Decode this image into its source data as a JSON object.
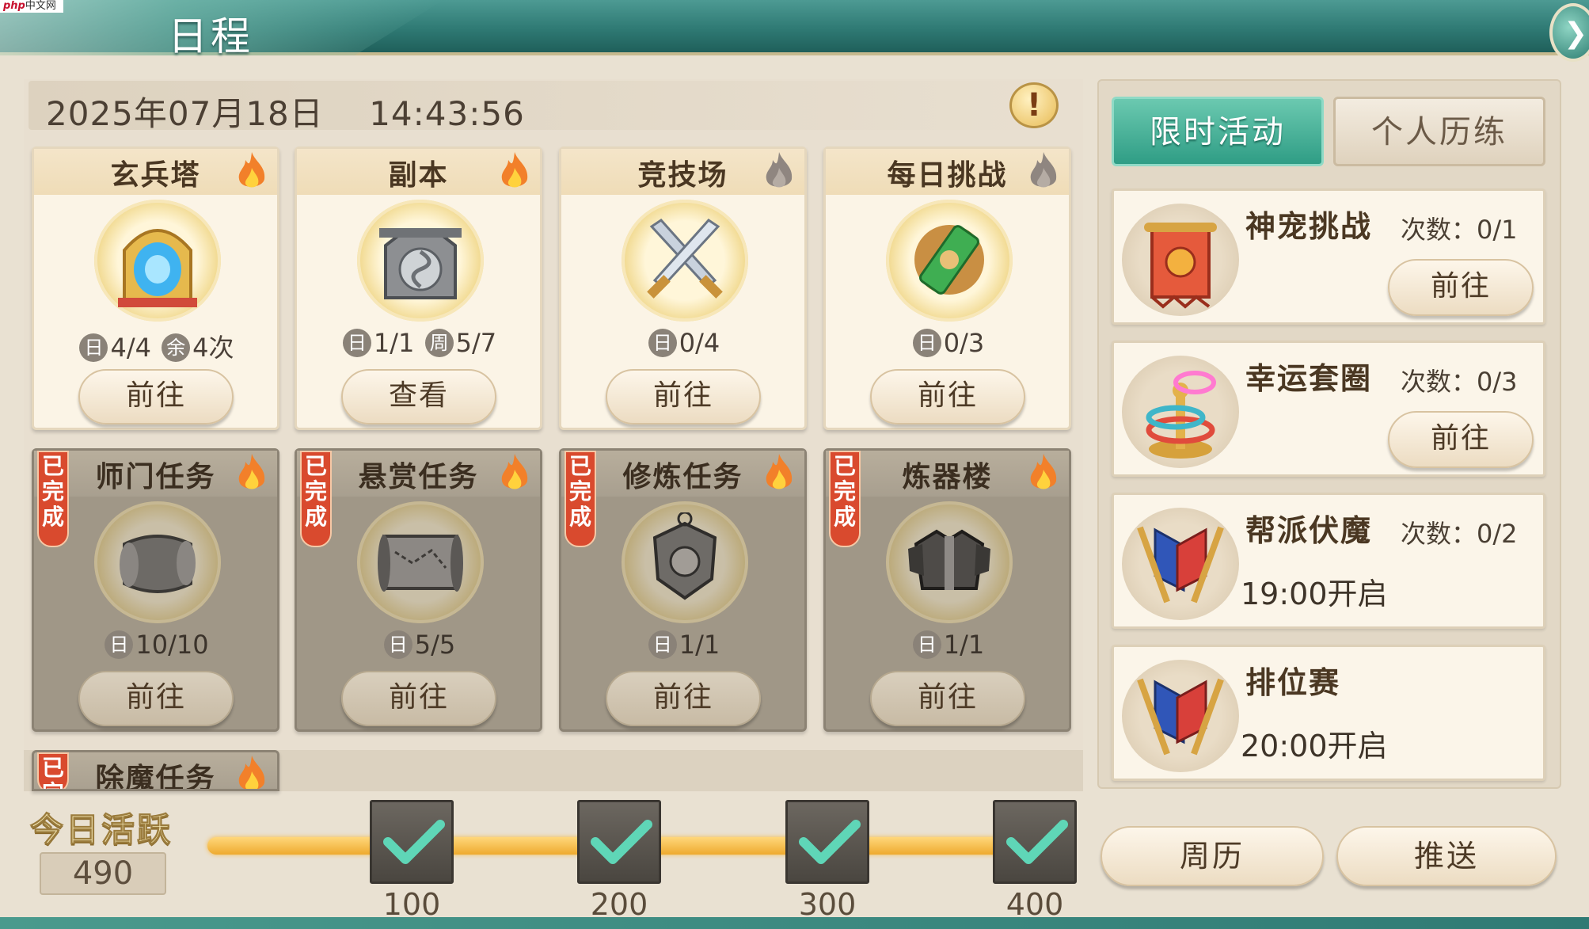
{
  "brand": {
    "prefix": "php",
    "suffix": "中文网"
  },
  "header": {
    "title": "日程",
    "close_icon": "swirl-close-icon"
  },
  "datebar": {
    "date": "2025年07月18日",
    "time": "14:43:56",
    "info_label": "!"
  },
  "cards": [
    {
      "name": "玄兵塔",
      "done": false,
      "hot": true,
      "icon": "portal-gate-icon",
      "stats": [
        {
          "tag": "日",
          "value": "4/4"
        },
        {
          "tag": "余",
          "value": "4次"
        }
      ],
      "button": "前往"
    },
    {
      "name": "副本",
      "done": false,
      "hot": true,
      "icon": "dungeon-gate-icon",
      "stats": [
        {
          "tag": "日",
          "value": "1/1"
        },
        {
          "tag": "周",
          "value": "5/7"
        }
      ],
      "button": "查看"
    },
    {
      "name": "竞技场",
      "done": false,
      "hot": false,
      "icon": "crossed-swords-icon",
      "stats": [
        {
          "tag": "日",
          "value": "0/4"
        }
      ],
      "button": "前往"
    },
    {
      "name": "每日挑战",
      "done": false,
      "hot": false,
      "icon": "scroll-icon",
      "stats": [
        {
          "tag": "日",
          "value": "0/3"
        }
      ],
      "button": "前往"
    },
    {
      "name": "师门任务",
      "done": true,
      "hot": true,
      "ribbon": "已完成",
      "icon": "scroll-roll-icon",
      "stats": [
        {
          "tag": "日",
          "value": "10/10"
        }
      ],
      "button": "前往"
    },
    {
      "name": "悬赏任务",
      "done": true,
      "hot": true,
      "ribbon": "已完成",
      "icon": "map-icon",
      "stats": [
        {
          "tag": "日",
          "value": "5/5"
        }
      ],
      "button": "前往"
    },
    {
      "name": "修炼任务",
      "done": true,
      "hot": true,
      "ribbon": "已完成",
      "icon": "shield-amulet-icon",
      "stats": [
        {
          "tag": "日",
          "value": "1/1"
        }
      ],
      "button": "前往"
    },
    {
      "name": "炼器楼",
      "done": true,
      "hot": true,
      "ribbon": "已完成",
      "icon": "armor-icon",
      "stats": [
        {
          "tag": "日",
          "value": "1/1"
        }
      ],
      "button": "前往"
    }
  ],
  "partial_card": {
    "name": "除魔任务",
    "ribbon": "已完"
  },
  "activity": {
    "label": "今日活跃",
    "value": "490",
    "progress": 1.0,
    "milestones": [
      {
        "value": "100",
        "claimed": true
      },
      {
        "value": "200",
        "claimed": true
      },
      {
        "value": "300",
        "claimed": true
      },
      {
        "value": "400",
        "claimed": true
      }
    ]
  },
  "tabs": [
    {
      "label": "限时活动",
      "active": true
    },
    {
      "label": "个人历练",
      "active": false
    }
  ],
  "events": [
    {
      "name": "神宠挑战",
      "count": "次数：0/1",
      "button": "前往",
      "icon": "banner-scroll-icon"
    },
    {
      "name": "幸运套圈",
      "count": "次数：0/3",
      "button": "前往",
      "icon": "ring-toss-icon"
    },
    {
      "name": "帮派伏魔",
      "count": "次数：0/2",
      "time": "19:00开启",
      "icon": "crossed-flags-icon"
    },
    {
      "name": "排位赛",
      "time": "20:00开启",
      "icon": "crossed-flags-icon"
    }
  ],
  "bottom_buttons": {
    "calendar": "周历",
    "push": "推送"
  },
  "colors": {
    "accent": "#2f9d85",
    "header": "#2f7a74",
    "ribbon": "#d94a2e",
    "progress": "#eeaa2e"
  }
}
